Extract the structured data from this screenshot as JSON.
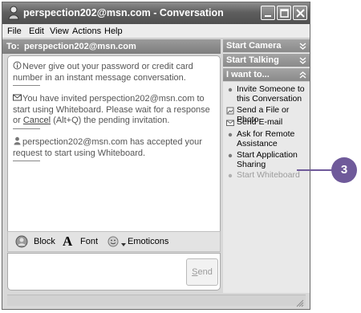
{
  "window": {
    "title": "perspection202@msn.com - Conversation",
    "icon": "msn-buddy-icon",
    "controls": [
      "minimize-icon",
      "maximize-icon",
      "close-icon"
    ]
  },
  "menu": {
    "items": [
      "File",
      "Edit",
      "View",
      "Actions",
      "Help"
    ]
  },
  "to_bar": {
    "label": "To:",
    "value": "perspection202@msn.com"
  },
  "messages": [
    {
      "icon": "info-icon",
      "text": "Never give out your password or credit card number in an instant message conversation."
    },
    {
      "icon": "envelope-icon",
      "text_before": "You have invited perspection202@msn.com to start using Whiteboard. Please wait for a response or ",
      "link": "Cancel",
      "text_after": " (Alt+Q) the pending invitation."
    },
    {
      "icon": "buddy-icon",
      "text": "perspection202@msn.com has accepted your request to start using Whiteboard."
    }
  ],
  "format_toolbar": {
    "block_label": "Block",
    "font_label": "Font",
    "emoticons_label": "Emoticons"
  },
  "send": {
    "label": "Send",
    "accent_letter": "S"
  },
  "side_panel": {
    "sections": [
      "Start Camera",
      "Start Talking",
      "I want to..."
    ],
    "actions": [
      {
        "label": "Invite Someone to this Conversation",
        "icon": "bullet-icon",
        "enabled": true
      },
      {
        "label": "Send a File or Photo",
        "icon": "file-photo-icon",
        "enabled": true
      },
      {
        "label": "Send E-mail",
        "icon": "email-icon",
        "enabled": true
      },
      {
        "label": "Ask for Remote Assistance",
        "icon": "bullet-icon",
        "enabled": true
      },
      {
        "label": "Start Application Sharing",
        "icon": "bullet-icon",
        "enabled": true
      },
      {
        "label": "Start Whiteboard",
        "icon": "bullet-icon",
        "enabled": false
      }
    ]
  },
  "callout": {
    "number": "3",
    "color": "#6f5a9a"
  }
}
